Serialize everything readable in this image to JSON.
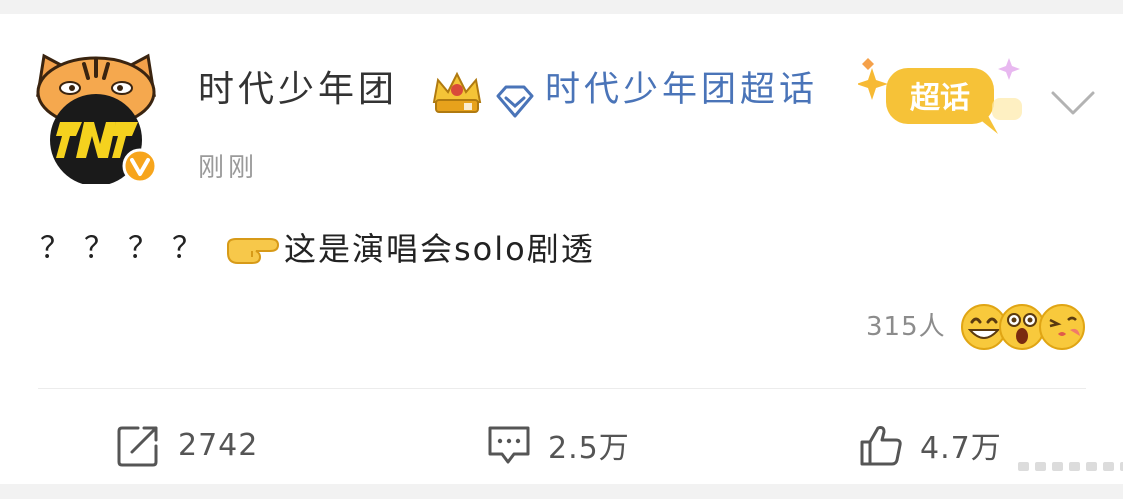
{
  "post": {
    "author": "时代少年团",
    "topic": "时代少年团超话",
    "supertopic_badge": "超话",
    "timestamp": "刚刚",
    "question_marks": [
      "？",
      "？",
      "？",
      "？"
    ],
    "body_text": "这是演唱会solo剧透",
    "reaction_count": "315人"
  },
  "actions": {
    "repost_count": "2742",
    "comment_count": "2.5万",
    "like_count": "4.7万"
  },
  "colors": {
    "author_text": "#333333",
    "topic_link": "#4a74b8",
    "muted": "#9a9a9a",
    "badge_gold": "#f6b21e"
  },
  "icons": {
    "avatar": "tiger-logo-avatar",
    "verified": "verified-v-icon",
    "crown": "crown-icon",
    "topic": "diamond-icon",
    "repost": "repost-icon",
    "comment": "comment-icon",
    "like": "thumbs-up-icon"
  }
}
